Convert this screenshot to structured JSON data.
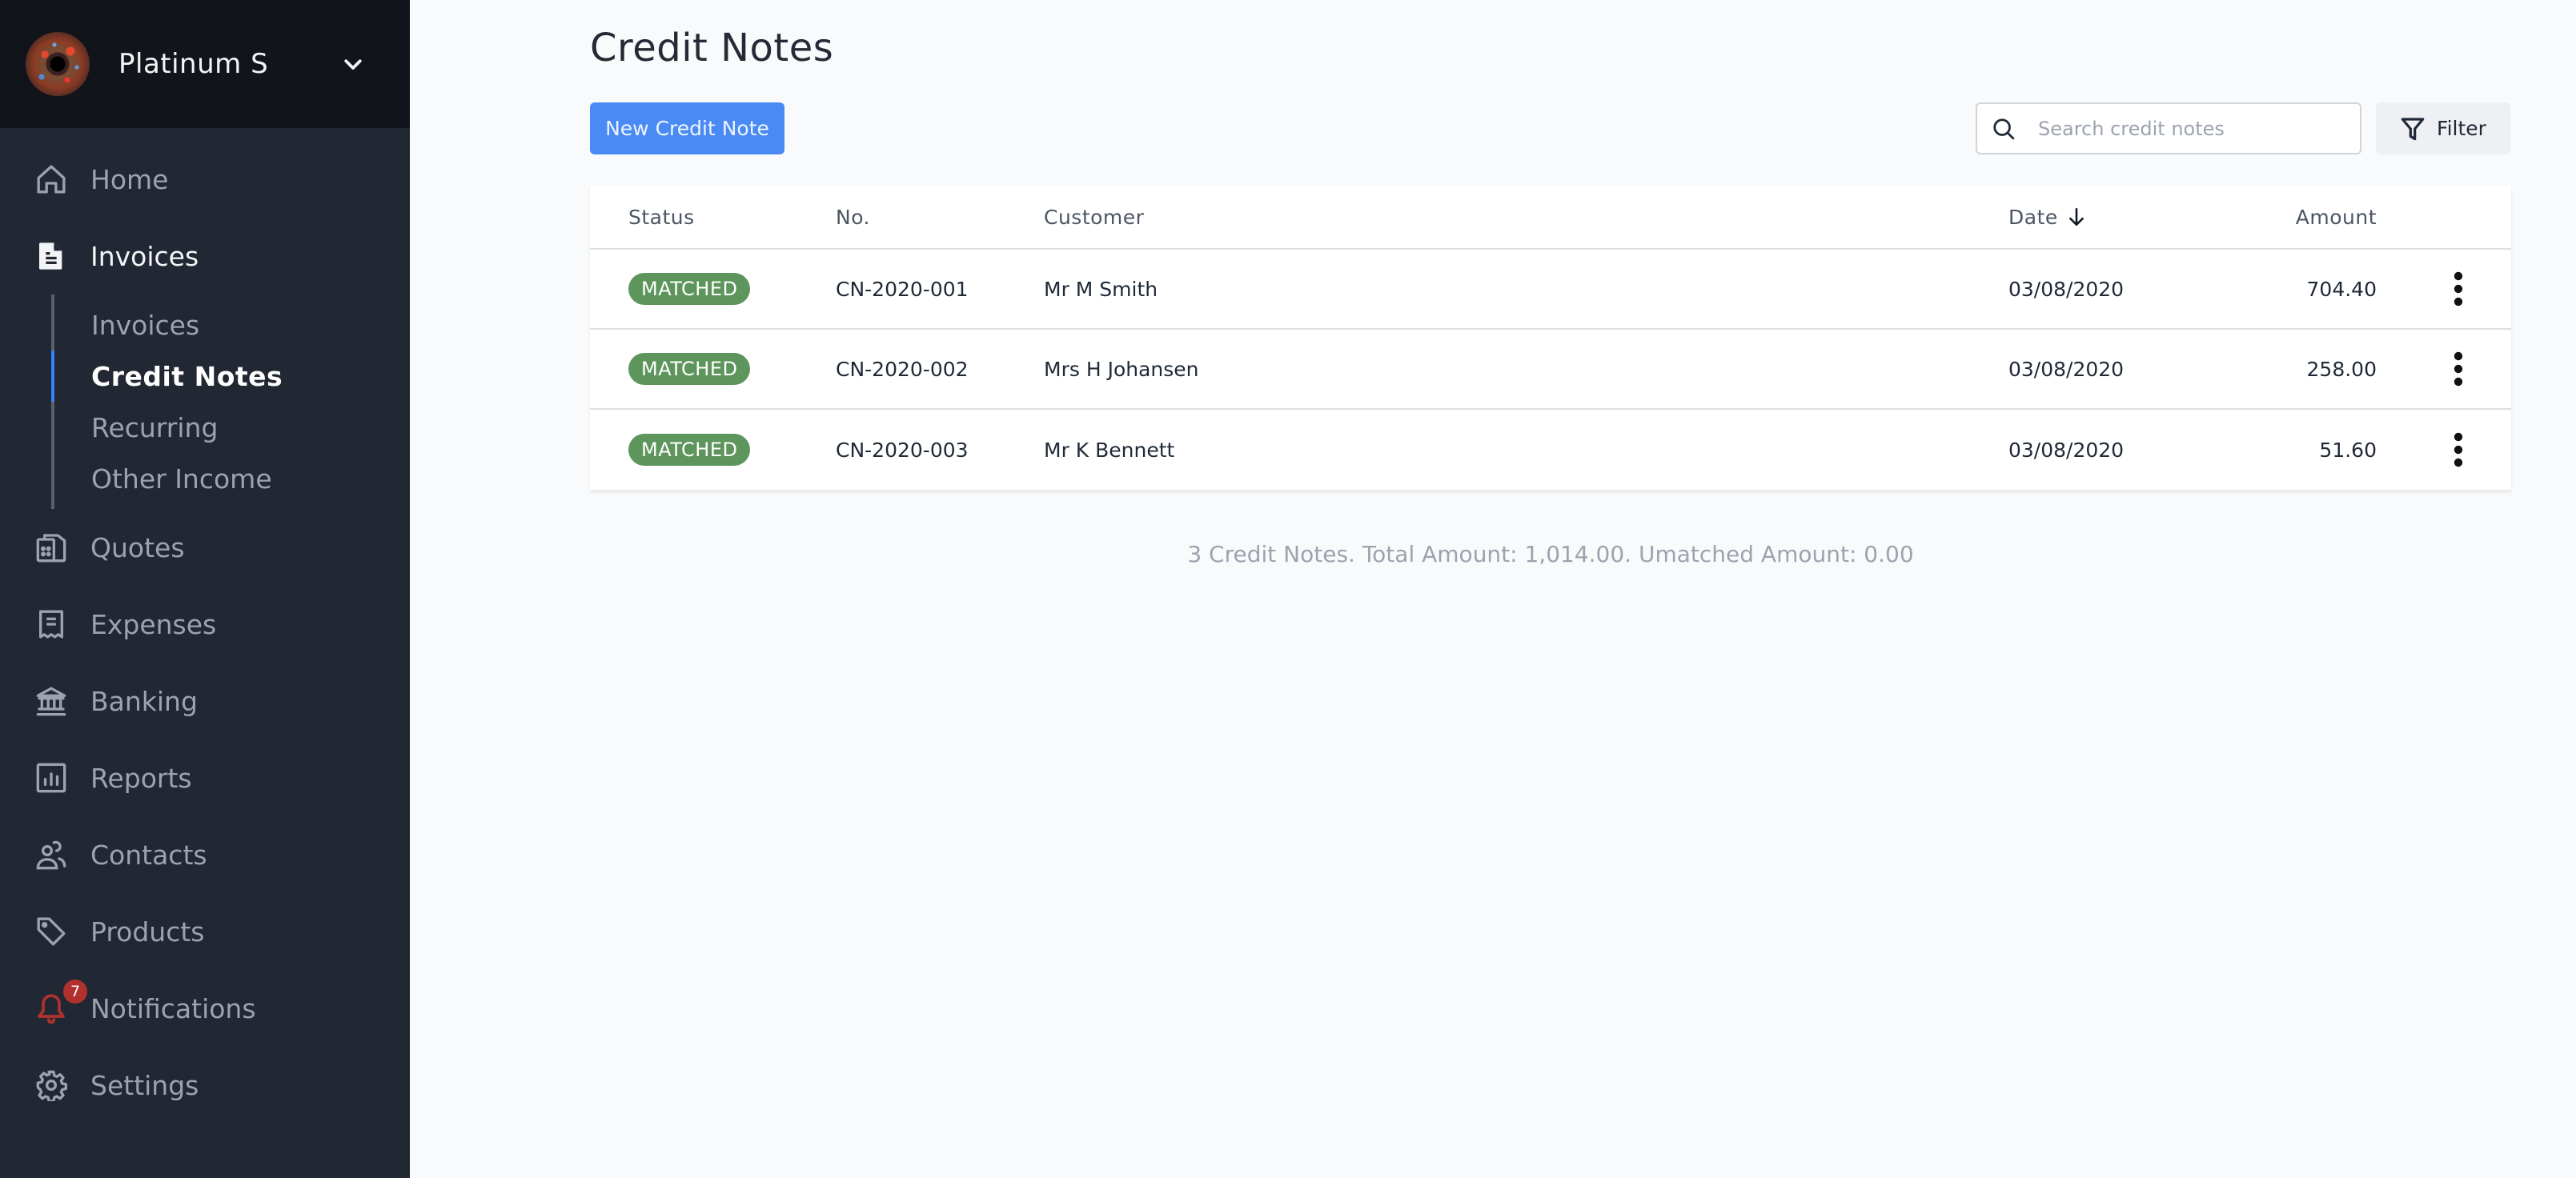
{
  "sidebar": {
    "org_name": "Platinum S",
    "nav": [
      {
        "id": "home",
        "label": "Home",
        "icon": "home-icon"
      },
      {
        "id": "invoices",
        "label": "Invoices",
        "icon": "document-icon",
        "active": true
      },
      {
        "id": "quotes",
        "label": "Quotes",
        "icon": "quotes-icon"
      },
      {
        "id": "expenses",
        "label": "Expenses",
        "icon": "receipt-icon"
      },
      {
        "id": "banking",
        "label": "Banking",
        "icon": "bank-icon"
      },
      {
        "id": "reports",
        "label": "Reports",
        "icon": "chart-bar-icon"
      },
      {
        "id": "contacts",
        "label": "Contacts",
        "icon": "users-icon"
      },
      {
        "id": "products",
        "label": "Products",
        "icon": "tag-icon"
      },
      {
        "id": "notifications",
        "label": "Notifications",
        "icon": "bell-icon",
        "badge": "7"
      },
      {
        "id": "settings",
        "label": "Settings",
        "icon": "gear-icon"
      }
    ],
    "invoices_subnav": [
      {
        "label": "Invoices"
      },
      {
        "label": "Credit Notes",
        "active": true
      },
      {
        "label": "Recurring"
      },
      {
        "label": "Other Income"
      }
    ]
  },
  "main": {
    "title": "Credit Notes",
    "new_button": "New Credit Note",
    "search": {
      "placeholder": "Search credit notes",
      "value": ""
    },
    "filter_button": "Filter",
    "table": {
      "columns": {
        "status": "Status",
        "no": "No.",
        "customer": "Customer",
        "date": "Date",
        "amount": "Amount"
      },
      "sort": {
        "column": "date",
        "direction": "descending"
      },
      "rows": [
        {
          "status": "MATCHED",
          "no": "CN-2020-001",
          "customer": "Mr M Smith",
          "date": "03/08/2020",
          "amount": "704.40"
        },
        {
          "status": "MATCHED",
          "no": "CN-2020-002",
          "customer": "Mrs H Johansen",
          "date": "03/08/2020",
          "amount": "258.00"
        },
        {
          "status": "MATCHED",
          "no": "CN-2020-003",
          "customer": "Mr K Bennett",
          "date": "03/08/2020",
          "amount": "51.60"
        }
      ]
    },
    "summary": "3 Credit Notes. Total Amount: 1,014.00. Umatched Amount: 0.00"
  },
  "colors": {
    "accent": "#4a8af4",
    "status_matched": "#5d955c",
    "sidebar_bg": "#222833",
    "sidebar_header_bg": "#11141b",
    "notification_badge": "#b0312d"
  }
}
